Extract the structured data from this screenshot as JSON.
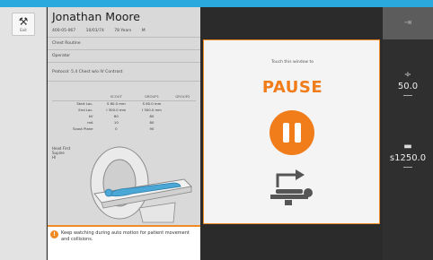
{
  "rail": {
    "tool_label": "Exit"
  },
  "patient": {
    "name": "Jonathan Moore",
    "id": "400-05-067",
    "dob": "10/01/74",
    "age": "78 Years",
    "sex": "M",
    "exam": "Chest  Routine",
    "operator": "Operator",
    "protocol": "Protocol: 5.4 Chest w/o IV Contrast"
  },
  "scan_table": {
    "headers": [
      "SCOUT",
      "GROUP1",
      "GROUP2"
    ],
    "rows": [
      [
        "Start Loc.",
        "S 60.0 mm",
        "S 60.0 mm"
      ],
      [
        "End Loc.",
        "I 300.0 mm",
        "I 300.0 mm"
      ],
      [
        "kV",
        "80",
        "80"
      ],
      [
        "mA",
        "10",
        "80"
      ],
      [
        "Scout Plane",
        "0",
        "90"
      ]
    ]
  },
  "position": {
    "line1": "Head First",
    "line2": "Supine",
    "line3": "Hl"
  },
  "warning": {
    "text": "Keep watching during auto motion for patient movement and collisions."
  },
  "pause_card": {
    "hint": "Touch this window to",
    "title": "PAUSE"
  },
  "right": {
    "exit_icon": "exit-icon",
    "value1": "50.0",
    "value2": "s1250.0"
  },
  "colors": {
    "accent": "#f07c1a",
    "topbar": "#2aa9df"
  }
}
